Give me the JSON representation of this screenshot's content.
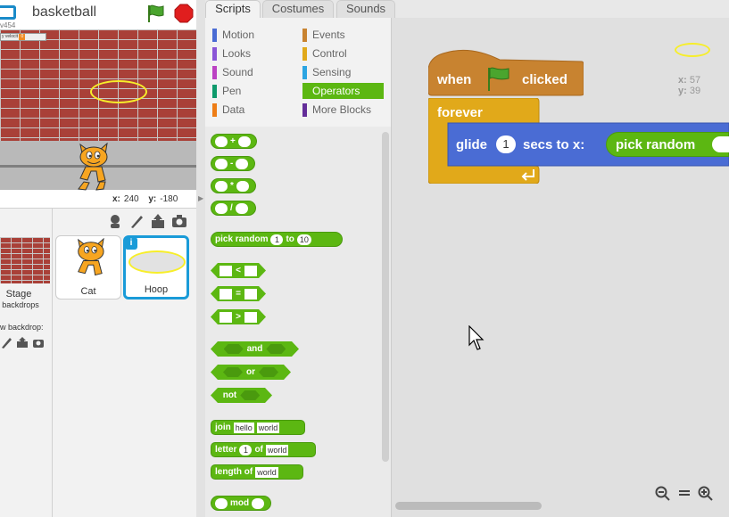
{
  "project": {
    "title": "basketball",
    "version": "v454"
  },
  "stage": {
    "variable": {
      "label": "y velocit",
      "value": "0"
    },
    "coords": {
      "x_label": "x:",
      "x_value": "240",
      "y_label": "y:",
      "y_value": "-180"
    }
  },
  "sprites_pane": {
    "stage_label": "Stage",
    "backdrops_label": "backdrops",
    "new_backdrop_label": "w backdrop:",
    "sprites": [
      {
        "name": "Cat"
      },
      {
        "name": "Hoop",
        "selected": true
      }
    ]
  },
  "tabs": [
    "Scripts",
    "Costumes",
    "Sounds"
  ],
  "categories": [
    {
      "label": "Motion",
      "color": "#4a6cd4"
    },
    {
      "label": "Looks",
      "color": "#8a55d7"
    },
    {
      "label": "Sound",
      "color": "#bb42c3"
    },
    {
      "label": "Pen",
      "color": "#0e9a6c"
    },
    {
      "label": "Data",
      "color": "#ee7d16"
    },
    {
      "label": "Events",
      "color": "#c88330"
    },
    {
      "label": "Control",
      "color": "#e1a91a"
    },
    {
      "label": "Sensing",
      "color": "#2ca5e2"
    },
    {
      "label": "Operators",
      "color": "#5cb712",
      "active": true
    },
    {
      "label": "More Blocks",
      "color": "#632d99"
    }
  ],
  "palette": {
    "ops": [
      "+",
      "-",
      "*",
      "/"
    ],
    "pick_random": {
      "label1": "pick random",
      "a": "1",
      "label2": "to",
      "b": "10"
    },
    "compare": [
      "<",
      "=",
      ">"
    ],
    "logic": [
      "and",
      "or",
      "not"
    ],
    "join": {
      "label": "join",
      "a": "hello",
      "b": "world"
    },
    "letter": {
      "label1": "letter",
      "a": "1",
      "label2": "of",
      "b": "world"
    },
    "length": {
      "label": "length of",
      "a": "world"
    },
    "mod": {
      "label": "mod"
    }
  },
  "script": {
    "hat": {
      "when": "when",
      "clicked": "clicked"
    },
    "forever": "forever",
    "glide": {
      "label1": "glide",
      "secs": "1",
      "label2": "secs to x:",
      "reporter": "pick random"
    }
  },
  "sprite_position": {
    "x_label": "x:",
    "x": "57",
    "y_label": "y:",
    "y": "39"
  },
  "colors": {
    "events": "#c88330",
    "control": "#e1a91a",
    "motion": "#4a6cd4",
    "operators": "#5cb712",
    "selection": "#1a9bd8"
  }
}
